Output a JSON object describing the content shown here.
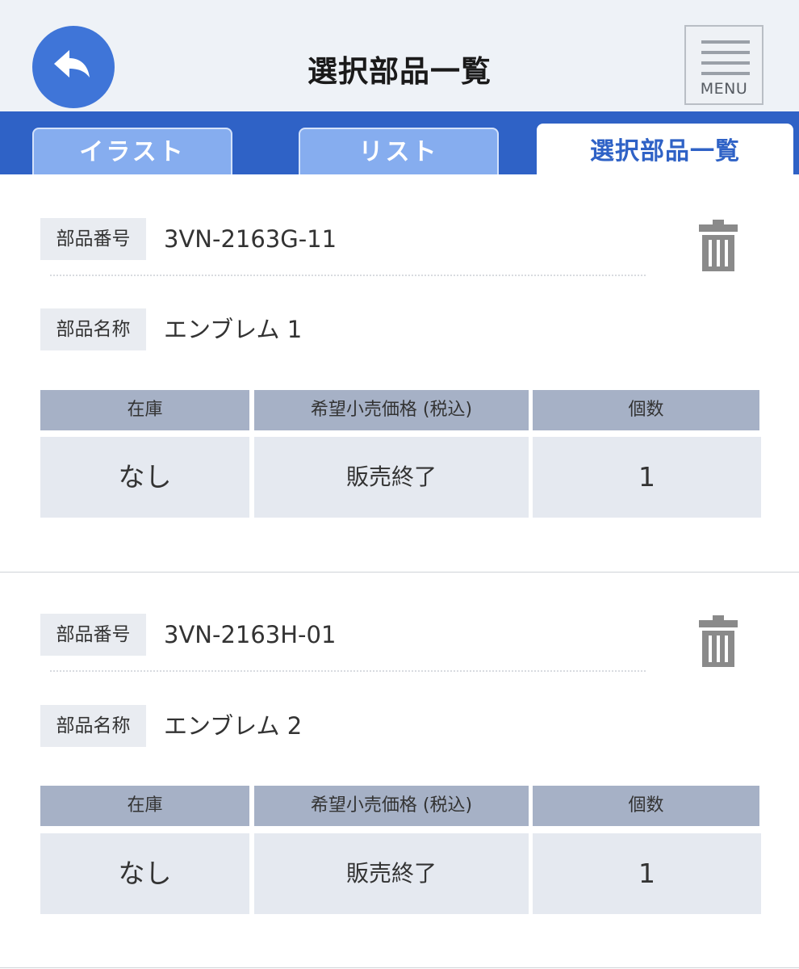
{
  "header": {
    "title": "選択部品一覧",
    "menu_label": "MENU"
  },
  "tabs": [
    {
      "label": "イラスト",
      "active": false
    },
    {
      "label": "リスト",
      "active": false
    },
    {
      "label": "選択部品一覧",
      "active": true
    }
  ],
  "colors": {
    "accent": "#2f62c6",
    "back_button": "#3f75d8",
    "tab_inactive": "#86adef",
    "table_header": "#a6b1c6",
    "table_cell": "#e5e9f0"
  },
  "table_headers": [
    "在庫",
    "希望小売価格 (税込)",
    "個数"
  ],
  "parts": [
    {
      "number_label": "部品番号",
      "number": "3VN-2163G-11",
      "name_label": "部品名称",
      "name": "エンブレム 1",
      "stock": "なし",
      "price": "販売終了",
      "quantity": "1"
    },
    {
      "number_label": "部品番号",
      "number": "3VN-2163H-01",
      "name_label": "部品名称",
      "name": "エンブレム 2",
      "stock": "なし",
      "price": "販売終了",
      "quantity": "1"
    }
  ]
}
